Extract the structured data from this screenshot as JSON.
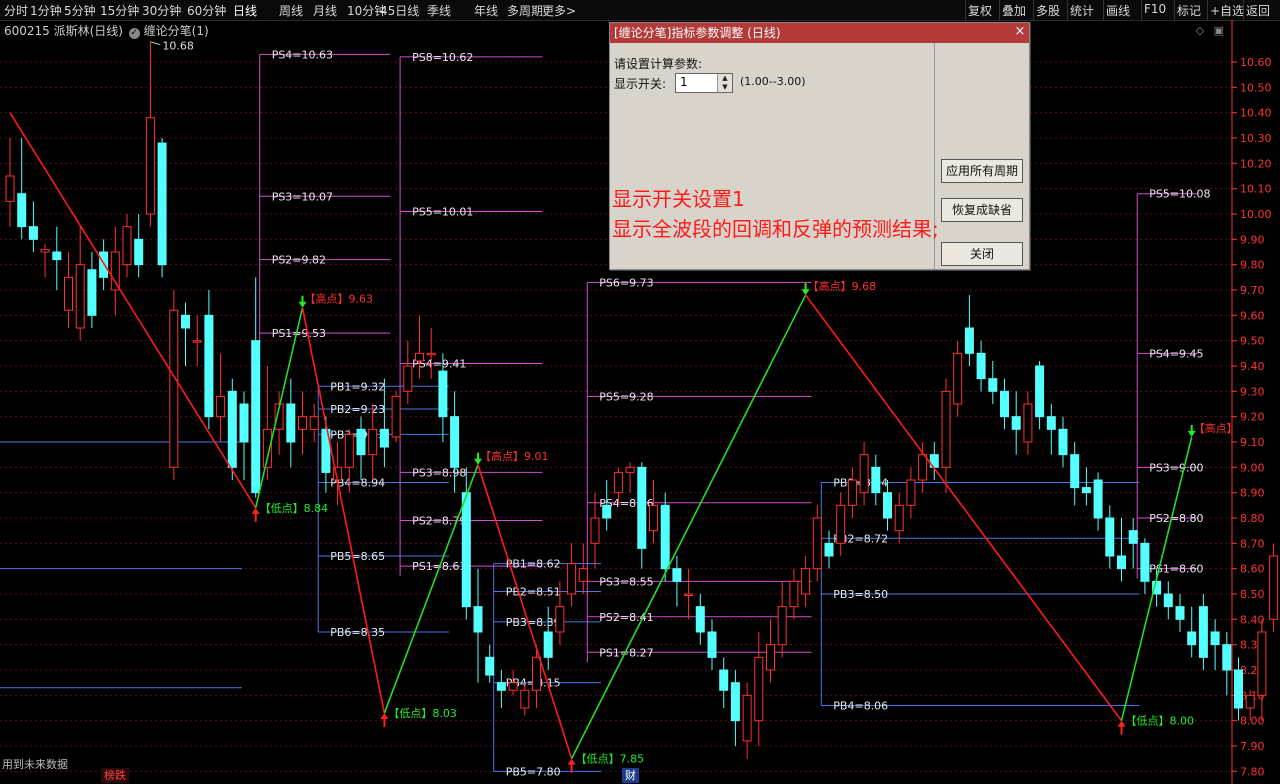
{
  "toolbar": {
    "left_items": [
      "分时",
      "1分钟",
      "5分钟",
      "15分钟",
      "30分钟",
      "60分钟",
      "日线",
      "周线",
      "月线",
      "10分钟",
      "45日线",
      "季线",
      "年线",
      "多周期",
      "更多>"
    ],
    "active": "日线",
    "right_items": [
      "复权",
      "叠加",
      "多股",
      "统计",
      "画线",
      "F10",
      "标记",
      "+自选",
      "返回"
    ]
  },
  "header": {
    "stock": "600215 派斯林(日线)",
    "indicator": "缠论分笔(1)",
    "high_label": "10.68"
  },
  "colors": {
    "up": "#ff3030",
    "down": "#54ffff",
    "bi_down": "#ff1a1a",
    "bi_up": "#22dd22",
    "ps_line": "#d24ed2",
    "pb_line": "#4a78e0",
    "axis": "#ff3333"
  },
  "chart_data": {
    "type": "candlestick",
    "y_axis_ticks": [
      "10.60",
      "10.50",
      "10.40",
      "10.30",
      "10.20",
      "10.10",
      "10.00",
      "9.90",
      "9.80",
      "9.70",
      "9.60",
      "9.50",
      "9.40",
      "9.30",
      "9.20",
      "9.10",
      "9.00",
      "8.90",
      "8.80",
      "8.70",
      "8.60",
      "8.50",
      "8.40",
      "8.30",
      "8.20",
      "8.10",
      "8.00",
      "7.90",
      "7.80"
    ],
    "ylim": [
      7.8,
      10.7
    ],
    "candles": [
      [
        10.05,
        10.15,
        10.3,
        9.95
      ],
      [
        10.08,
        9.95,
        10.3,
        9.9
      ],
      [
        9.95,
        9.9,
        10.05,
        9.85
      ],
      [
        9.85,
        9.86,
        9.88,
        9.75
      ],
      [
        9.85,
        9.82,
        9.95,
        9.7
      ],
      [
        9.62,
        9.75,
        9.85,
        9.55
      ],
      [
        9.55,
        9.8,
        9.95,
        9.5
      ],
      [
        9.78,
        9.6,
        9.85,
        9.55
      ],
      [
        9.85,
        9.75,
        9.9,
        9.7
      ],
      [
        9.7,
        9.85,
        9.95,
        9.6
      ],
      [
        9.8,
        9.95,
        10.0,
        9.75
      ],
      [
        9.9,
        9.8,
        10.0,
        9.75
      ],
      [
        10.0,
        10.38,
        10.68,
        9.95
      ],
      [
        10.28,
        9.8,
        10.3,
        9.75
      ],
      [
        9.0,
        9.62,
        9.7,
        8.95
      ],
      [
        9.6,
        9.55,
        9.65,
        9.4
      ],
      [
        9.5,
        9.5,
        9.6,
        9.4
      ],
      [
        9.6,
        9.2,
        9.7,
        9.15
      ],
      [
        9.2,
        9.28,
        9.45,
        9.1
      ],
      [
        9.3,
        9.0,
        9.35,
        8.95
      ],
      [
        9.25,
        9.1,
        9.3,
        8.95
      ],
      [
        9.5,
        8.9,
        9.75,
        8.88
      ],
      [
        9.0,
        9.15,
        9.4,
        8.95
      ],
      [
        9.15,
        9.25,
        9.3,
        9.05
      ],
      [
        9.25,
        9.1,
        9.35,
        9.0
      ],
      [
        9.15,
        9.2,
        9.3,
        9.05
      ],
      [
        9.15,
        9.2,
        9.25,
        9.1
      ],
      [
        9.15,
        8.98,
        9.2,
        8.9
      ],
      [
        8.95,
        9.0,
        9.1,
        8.85
      ],
      [
        9.0,
        9.13,
        9.15,
        8.9
      ],
      [
        9.15,
        9.05,
        9.2,
        8.95
      ],
      [
        9.05,
        9.15,
        9.25,
        8.95
      ],
      [
        9.15,
        9.08,
        9.35,
        9.0
      ],
      [
        9.12,
        9.28,
        9.3,
        9.1
      ],
      [
        9.3,
        9.4,
        9.5,
        9.25
      ],
      [
        9.42,
        9.45,
        9.6,
        9.35
      ],
      [
        9.45,
        9.45,
        9.55,
        9.35
      ],
      [
        9.38,
        9.2,
        9.45,
        9.1
      ],
      [
        9.2,
        9.0,
        9.3,
        8.9
      ],
      [
        8.9,
        8.45,
        9.0,
        8.4
      ],
      [
        8.45,
        8.35,
        8.6,
        8.15
      ],
      [
        8.25,
        8.18,
        8.3,
        8.15
      ],
      [
        8.15,
        8.12,
        8.2,
        8.05
      ],
      [
        8.12,
        8.15,
        8.2,
        8.1
      ],
      [
        8.05,
        8.12,
        8.15,
        8.02
      ],
      [
        8.12,
        8.25,
        8.3,
        8.05
      ],
      [
        8.35,
        8.25,
        8.45,
        8.2
      ],
      [
        8.35,
        8.45,
        8.55,
        8.3
      ],
      [
        8.5,
        8.62,
        8.7,
        8.45
      ],
      [
        8.55,
        8.6,
        8.7,
        8.5
      ],
      [
        8.7,
        8.8,
        8.9,
        8.6
      ],
      [
        8.85,
        8.8,
        8.95,
        8.75
      ],
      [
        8.9,
        8.98,
        9.0,
        8.85
      ],
      [
        8.98,
        9.0,
        9.02,
        8.9
      ],
      [
        9.0,
        8.68,
        9.02,
        8.6
      ],
      [
        8.75,
        8.85,
        8.95,
        8.7
      ],
      [
        8.85,
        8.6,
        8.9,
        8.55
      ],
      [
        8.6,
        8.55,
        8.65,
        8.45
      ],
      [
        8.5,
        8.5,
        8.6,
        8.4
      ],
      [
        8.45,
        8.35,
        8.5,
        8.3
      ],
      [
        8.35,
        8.25,
        8.4,
        8.2
      ],
      [
        8.2,
        8.12,
        8.25,
        8.05
      ],
      [
        8.15,
        8.0,
        8.2,
        7.9
      ],
      [
        7.92,
        8.1,
        8.15,
        7.85
      ],
      [
        8.0,
        8.25,
        8.35,
        7.9
      ],
      [
        8.2,
        8.3,
        8.4,
        8.15
      ],
      [
        8.3,
        8.45,
        8.55,
        8.25
      ],
      [
        8.45,
        8.55,
        8.6,
        8.4
      ],
      [
        8.5,
        8.6,
        8.65,
        8.45
      ],
      [
        8.6,
        8.8,
        8.85,
        8.55
      ],
      [
        8.7,
        8.65,
        8.75,
        8.6
      ],
      [
        8.7,
        8.85,
        8.9,
        8.65
      ],
      [
        8.85,
        8.95,
        9.0,
        8.8
      ],
      [
        8.9,
        9.05,
        9.1,
        8.85
      ],
      [
        9.0,
        8.9,
        9.05,
        8.85
      ],
      [
        8.9,
        8.8,
        8.95,
        8.75
      ],
      [
        8.75,
        8.85,
        8.9,
        8.7
      ],
      [
        8.85,
        8.95,
        9.0,
        8.8
      ],
      [
        8.95,
        9.05,
        9.1,
        8.9
      ],
      [
        9.05,
        9.0,
        9.1,
        8.95
      ],
      [
        9.0,
        9.3,
        9.35,
        8.9
      ],
      [
        9.25,
        9.45,
        9.5,
        9.2
      ],
      [
        9.55,
        9.45,
        9.68,
        9.4
      ],
      [
        9.45,
        9.35,
        9.5,
        9.3
      ],
      [
        9.35,
        9.3,
        9.42,
        9.25
      ],
      [
        9.3,
        9.2,
        9.35,
        9.15
      ],
      [
        9.2,
        9.15,
        9.3,
        9.05
      ],
      [
        9.1,
        9.25,
        9.3,
        9.05
      ],
      [
        9.4,
        9.2,
        9.42,
        9.15
      ],
      [
        9.2,
        9.15,
        9.25,
        9.05
      ],
      [
        9.15,
        9.05,
        9.2,
        9.0
      ],
      [
        9.05,
        8.92,
        9.1,
        8.85
      ],
      [
        8.92,
        8.9,
        9.0,
        8.85
      ],
      [
        8.95,
        8.8,
        8.98,
        8.75
      ],
      [
        8.8,
        8.65,
        8.85,
        8.6
      ],
      [
        8.65,
        8.6,
        8.8,
        8.55
      ],
      [
        8.75,
        8.7,
        8.8,
        8.6
      ],
      [
        8.7,
        8.55,
        8.72,
        8.5
      ],
      [
        8.55,
        8.5,
        8.6,
        8.45
      ],
      [
        8.5,
        8.45,
        8.55,
        8.4
      ],
      [
        8.45,
        8.4,
        8.5,
        8.35
      ],
      [
        8.35,
        8.3,
        8.45,
        8.25
      ],
      [
        8.45,
        8.25,
        8.5,
        8.2
      ],
      [
        8.35,
        8.3,
        8.4,
        8.2
      ],
      [
        8.3,
        8.2,
        8.35,
        8.1
      ],
      [
        8.2,
        8.05,
        8.25,
        8.0
      ],
      [
        8.05,
        8.1,
        8.12,
        8.0
      ],
      [
        8.1,
        8.35,
        8.4,
        8.0
      ],
      [
        8.4,
        8.65,
        8.7,
        8.35
      ],
      [
        8.65,
        8.8,
        8.85,
        8.6
      ],
      [
        8.8,
        8.85,
        8.9,
        8.75
      ],
      [
        8.8,
        9.05,
        9.1,
        8.75
      ]
    ],
    "bi_segments": [
      {
        "from": [
          0,
          10.4
        ],
        "to": [
          21,
          8.84
        ],
        "dir": "down"
      },
      {
        "from": [
          21,
          8.84
        ],
        "to": [
          25,
          9.63
        ],
        "dir": "up"
      },
      {
        "from": [
          25,
          9.63
        ],
        "to": [
          32,
          8.03
        ],
        "dir": "down"
      },
      {
        "from": [
          32,
          8.03
        ],
        "to": [
          40,
          9.01
        ],
        "dir": "up"
      },
      {
        "from": [
          40,
          9.01
        ],
        "to": [
          48,
          7.85
        ],
        "dir": "down"
      },
      {
        "from": [
          48,
          7.85
        ],
        "to": [
          68,
          9.68
        ],
        "dir": "up"
      },
      {
        "from": [
          68,
          9.68
        ],
        "to": [
          95,
          8.0
        ],
        "dir": "down"
      },
      {
        "from": [
          95,
          8.0
        ],
        "to": [
          101,
          9.12
        ],
        "dir": "up"
      }
    ],
    "pivot_labels": [
      {
        "text": "【低点】8.84",
        "value": 8.84,
        "type": "low",
        "x": 21
      },
      {
        "text": "【高点】9.63",
        "value": 9.63,
        "type": "high",
        "x": 25
      },
      {
        "text": "【低点】8.03",
        "value": 8.03,
        "type": "low",
        "x": 32
      },
      {
        "text": "【高点】9.01",
        "value": 9.01,
        "type": "high",
        "x": 40
      },
      {
        "text": "【低点】7.85",
        "value": 7.85,
        "type": "low",
        "x": 48
      },
      {
        "text": "【高点】9.68",
        "value": 9.68,
        "type": "high",
        "x": 68
      },
      {
        "text": "【低点】8.00",
        "value": 8.0,
        "type": "low",
        "x": 95
      },
      {
        "text": "【高点】",
        "value": 9.12,
        "type": "high",
        "x": 101
      }
    ],
    "level_groups": [
      {
        "x": 21,
        "end": 32,
        "items": [
          [
            "PS4=10.63",
            10.63
          ],
          [
            "PS3=10.07",
            10.07
          ],
          [
            "PS2=9.82",
            9.82
          ],
          [
            "PS1=9.53",
            9.53
          ]
        ]
      },
      {
        "x": 26,
        "end": 37,
        "items": [
          [
            "PB1=9.32",
            9.32
          ],
          [
            "PB2=9.23",
            9.23
          ],
          [
            "PB3=9.13",
            9.13
          ],
          [
            "PB4=8.94",
            8.94
          ],
          [
            "PB5=8.65",
            8.65
          ],
          [
            "PB6=8.35",
            8.35
          ]
        ]
      },
      {
        "x": 33,
        "end": 45,
        "items": [
          [
            "PS8=10.62",
            10.62
          ],
          [
            "PS5=10.01",
            10.01
          ],
          [
            "PS4=9.41",
            9.41
          ],
          [
            "PS3=8.98",
            8.98
          ],
          [
            "PS2=8.79",
            8.79
          ],
          [
            "PS1=8.61",
            8.61
          ]
        ]
      },
      {
        "x": 41,
        "end": 50,
        "items": [
          [
            "PB1=8.62",
            8.62
          ],
          [
            "PB2=8.51",
            8.51
          ],
          [
            "PB3=8.39",
            8.39
          ],
          [
            "PB4=8.15",
            8.15
          ],
          [
            "PB5=7.80",
            7.8
          ]
        ]
      },
      {
        "x": 49,
        "end": 68,
        "items": [
          [
            "PS6=9.73",
            9.73
          ],
          [
            "PS5=9.28",
            9.28
          ],
          [
            "PS4=8.86",
            8.86
          ],
          [
            "PS3=8.55",
            8.55
          ],
          [
            "PS2=8.41",
            8.41
          ],
          [
            "PS1=8.27",
            8.27
          ]
        ]
      },
      {
        "x": 69,
        "end": 96,
        "items": [
          [
            "PB1=8.94",
            8.94
          ],
          [
            "PB2=8.72",
            8.72
          ],
          [
            "PB3=8.50",
            8.5
          ],
          [
            "PB4=8.06",
            8.06
          ]
        ]
      },
      {
        "x": 96,
        "end": 101,
        "items": [
          [
            "PS5=10.08",
            10.08
          ],
          [
            "PS4=9.45",
            9.45
          ],
          [
            "PS3=9.00",
            9.0
          ],
          [
            "PS2=8.80",
            8.8
          ],
          [
            "PS1=8.60",
            8.6
          ]
        ]
      }
    ],
    "left_blue_lines": [
      9.1,
      8.6,
      8.13
    ]
  },
  "dialog": {
    "title": "[缠论分笔]指标参数调整 (日线)",
    "close": "×",
    "prompt": "请设置计算参数:",
    "switch_label": "显示开关:",
    "switch_value": "1",
    "range": "(1.00--3.00)",
    "buttons": [
      "应用所有周期",
      "恢复成缺省",
      "关闭"
    ]
  },
  "annotation": {
    "line1": "显示开关设置1",
    "line2": "显示全波段的回调和反弹的预测结果;"
  },
  "bottom": {
    "left_text": "用到未来数据",
    "tag1": "榜跌",
    "tag2": "财"
  }
}
